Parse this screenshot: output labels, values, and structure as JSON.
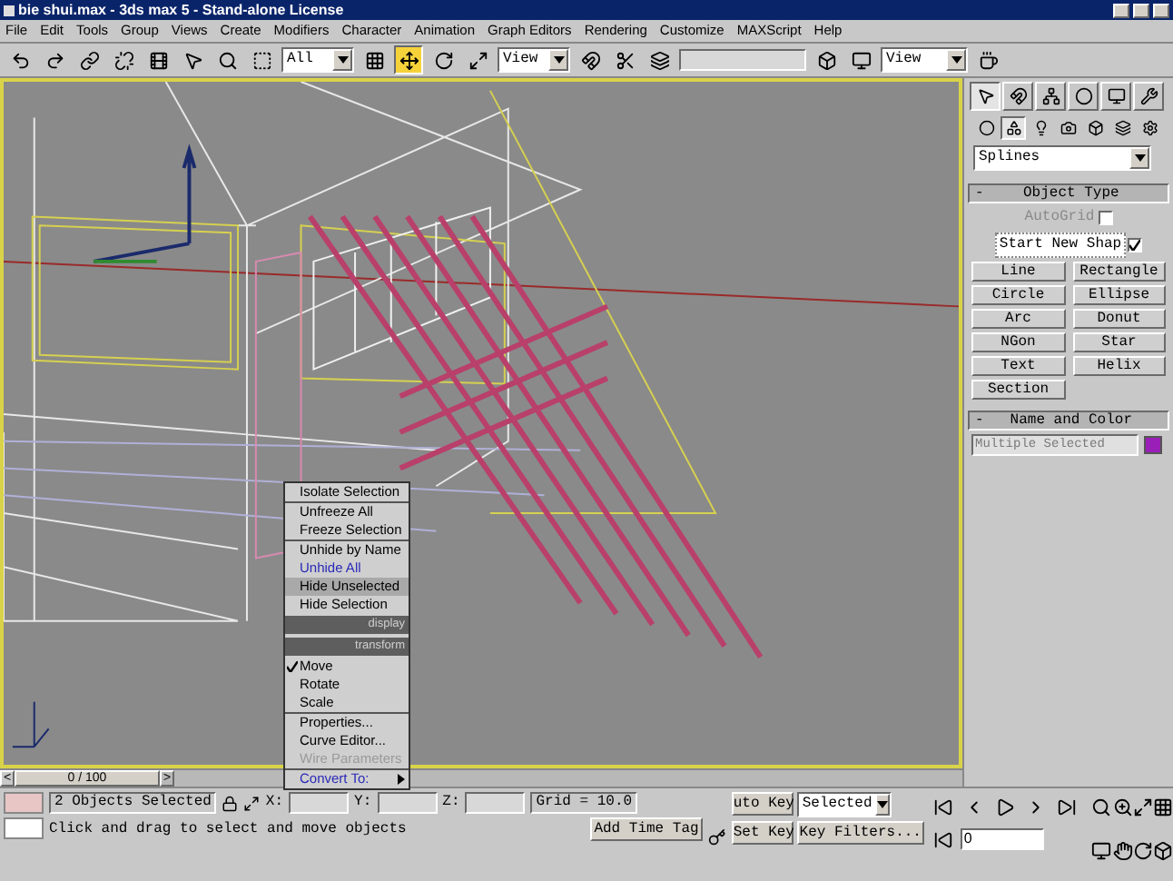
{
  "window": {
    "title": "bie shui.max - 3ds max 5 - Stand-alone License"
  },
  "menu_bar": [
    "File",
    "Edit",
    "Tools",
    "Group",
    "Views",
    "Create",
    "Modifiers",
    "Character",
    "Animation",
    "Graph Editors",
    "Rendering",
    "Customize",
    "MAXScript",
    "Help"
  ],
  "toolbar": {
    "selection_filter": "All",
    "reference_coordinate": "View",
    "render_view": "View",
    "transform_tools": [
      {
        "kind": "move",
        "selected": true
      },
      {
        "kind": "rotate",
        "selected": false
      },
      {
        "kind": "scale",
        "selected": false
      }
    ]
  },
  "quad_menu": [
    {
      "kind": "item",
      "label": "Isolate Selection",
      "checked": false,
      "disabled": false,
      "selected": false,
      "separator_after": true
    },
    {
      "kind": "item",
      "label": "Unfreeze All",
      "checked": false,
      "disabled": false,
      "selected": false,
      "separator_after": false
    },
    {
      "kind": "item",
      "label": "Freeze Selection",
      "checked": false,
      "disabled": false,
      "selected": false,
      "separator_after": true
    },
    {
      "kind": "item",
      "label": "Unhide by Name",
      "checked": false,
      "disabled": false,
      "selected": false,
      "separator_after": false
    },
    {
      "kind": "item",
      "label": "Unhide All",
      "color": "#2a2ab8",
      "checked": false,
      "disabled": false,
      "selected": false,
      "separator_after": false
    },
    {
      "kind": "item",
      "label": "Hide Unselected",
      "checked": false,
      "disabled": false,
      "selected": true,
      "separator_after": false
    },
    {
      "kind": "item",
      "label": "Hide Selection",
      "checked": false,
      "disabled": false,
      "selected": false,
      "separator_after": false
    },
    {
      "kind": "header",
      "label": "display"
    },
    {
      "kind": "header",
      "label": "transform"
    },
    {
      "kind": "item",
      "label": "Move",
      "checked": true,
      "disabled": false,
      "selected": false,
      "separator_after": false
    },
    {
      "kind": "item",
      "label": "Rotate",
      "checked": false,
      "disabled": false,
      "selected": false,
      "separator_after": false
    },
    {
      "kind": "item",
      "label": "Scale",
      "checked": false,
      "disabled": false,
      "selected": false,
      "separator_after": true
    },
    {
      "kind": "item",
      "label": "Properties...",
      "checked": false,
      "disabled": false,
      "selected": false,
      "separator_after": false
    },
    {
      "kind": "item",
      "label": "Curve Editor...",
      "checked": false,
      "disabled": false,
      "selected": false,
      "separator_after": false
    },
    {
      "kind": "item",
      "label": "Wire Parameters",
      "checked": false,
      "disabled": true,
      "selected": false,
      "separator_after": true
    },
    {
      "kind": "submenu",
      "label": "Convert To:",
      "color": "#2a2ab8",
      "checked": false,
      "disabled": false,
      "selected": false,
      "separator_after": false
    }
  ],
  "command_panel": {
    "tabs": [
      {
        "kind": "create",
        "selected": true
      },
      {
        "kind": "modify",
        "selected": false
      },
      {
        "kind": "hierarchy",
        "selected": false
      },
      {
        "kind": "motion",
        "selected": false
      },
      {
        "kind": "display",
        "selected": false
      },
      {
        "kind": "utilities",
        "selected": false
      }
    ],
    "categories": [
      {
        "kind": "geometry",
        "selected": false
      },
      {
        "kind": "shapes",
        "selected": true
      },
      {
        "kind": "lights",
        "selected": false
      },
      {
        "kind": "cameras",
        "selected": false
      },
      {
        "kind": "helpers",
        "selected": false
      },
      {
        "kind": "spacewarps",
        "selected": false
      },
      {
        "kind": "systems",
        "selected": false
      }
    ],
    "subcategory": "Splines",
    "object_type": {
      "title": "Object Type",
      "collapse_sign": "-",
      "autogrid": {
        "label": "AutoGrid",
        "checked": false,
        "disabled": true
      },
      "start_new_shape": {
        "label": "Start New Shap",
        "checked": true
      },
      "buttons": [
        "Line",
        "Rectangle",
        "Circle",
        "Ellipse",
        "Arc",
        "Donut",
        "NGon",
        "Star",
        "Text",
        "Helix",
        "Section"
      ]
    },
    "name_and_color": {
      "title": "Name and Color",
      "collapse_sign": "-",
      "name": "Multiple Selected",
      "color": "#9a1fb8"
    }
  },
  "time_slider": {
    "position": "0 / 100",
    "level": 0,
    "prev": "<",
    "next": ">"
  },
  "status_bar": {
    "selection": "2 Objects Selected",
    "x_label": "X:",
    "y_label": "Y:",
    "z_label": "Z:",
    "grid": "Grid = 10.0",
    "prompt": "Click and drag to select and move objects",
    "time_tag": "Add Time Tag",
    "auto_key": "uto Key",
    "key_mode": "Selected",
    "set_key": "Set Key",
    "key_filters": "Key Filters...",
    "frame": "0"
  }
}
